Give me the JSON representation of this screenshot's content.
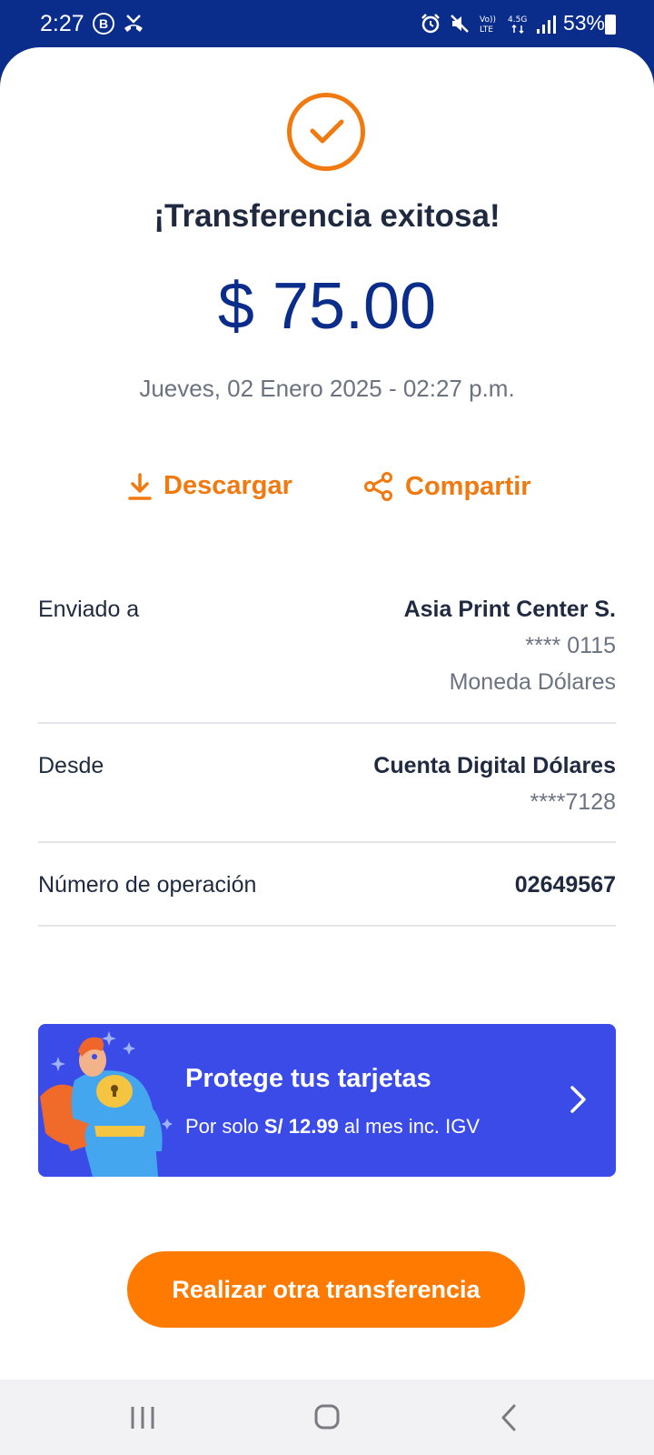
{
  "status_bar": {
    "time": "2:27",
    "left_icons": [
      "b-circle-icon",
      "phone-missed-icon"
    ],
    "right_icons": [
      "alarm-icon",
      "mute-icon",
      "volte-icon",
      "4g-icon",
      "signal-icon"
    ],
    "battery": "53%"
  },
  "receipt": {
    "title": "¡Transferencia exitosa!",
    "amount": "$ 75.00",
    "datetime": "Jueves, 02 Enero 2025 - 02:27 p.m.",
    "download_label": "Descargar",
    "share_label": "Compartir"
  },
  "details": {
    "sent_to": {
      "label": "Enviado a",
      "name": "Asia Print Center S.",
      "account": "**** 0115",
      "currency": "Moneda Dólares"
    },
    "from": {
      "label": "Desde",
      "name": "Cuenta Digital Dólares",
      "account": "****7128"
    },
    "operation": {
      "label": "Número de operación",
      "number": "02649567"
    }
  },
  "promo": {
    "title": "Protege tus tarjetas",
    "sub_prefix": "Por solo ",
    "sub_price": "S/ 12.99",
    "sub_suffix": " al mes inc. IGV"
  },
  "cta": {
    "label": "Realizar otra transferencia"
  },
  "colors": {
    "brand_blue": "#0a2d8c",
    "accent_orange": "#f07a10",
    "promo_blue": "#3a4be8",
    "cta_orange": "#ff7a00"
  }
}
